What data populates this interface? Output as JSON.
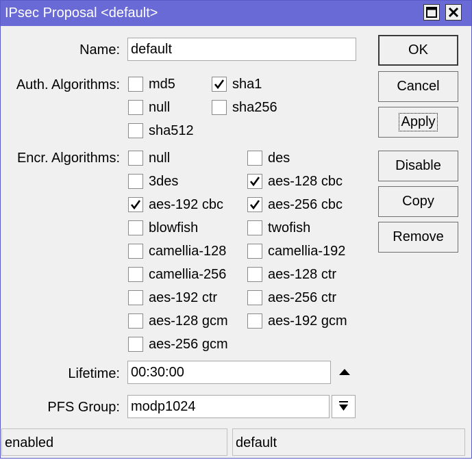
{
  "window": {
    "title": "IPsec Proposal <default>"
  },
  "form": {
    "name_label": "Name:",
    "name_value": "default",
    "auth_label": "Auth. Algorithms:",
    "auth": [
      {
        "label": "md5",
        "checked": false
      },
      {
        "label": "sha1",
        "checked": true
      },
      {
        "label": "null",
        "checked": false
      },
      {
        "label": "sha256",
        "checked": false
      },
      {
        "label": "sha512",
        "checked": false
      }
    ],
    "encr_label": "Encr. Algorithms:",
    "encr": [
      {
        "label": "null",
        "checked": false
      },
      {
        "label": "des",
        "checked": false
      },
      {
        "label": "3des",
        "checked": false
      },
      {
        "label": "aes-128 cbc",
        "checked": true
      },
      {
        "label": "aes-192 cbc",
        "checked": true
      },
      {
        "label": "aes-256 cbc",
        "checked": true
      },
      {
        "label": "blowfish",
        "checked": false
      },
      {
        "label": "twofish",
        "checked": false
      },
      {
        "label": "camellia-128",
        "checked": false
      },
      {
        "label": "camellia-192",
        "checked": false
      },
      {
        "label": "camellia-256",
        "checked": false
      },
      {
        "label": "aes-128 ctr",
        "checked": false
      },
      {
        "label": "aes-192 ctr",
        "checked": false
      },
      {
        "label": "aes-256 ctr",
        "checked": false
      },
      {
        "label": "aes-128 gcm",
        "checked": false
      },
      {
        "label": "aes-192 gcm",
        "checked": false
      },
      {
        "label": "aes-256 gcm",
        "checked": false
      }
    ],
    "lifetime_label": "Lifetime:",
    "lifetime_value": "00:30:00",
    "pfs_label": "PFS Group:",
    "pfs_value": "modp1024"
  },
  "buttons": {
    "ok": "OK",
    "cancel": "Cancel",
    "apply": "Apply",
    "disable": "Disable",
    "copy": "Copy",
    "remove": "Remove"
  },
  "status": {
    "left": "enabled",
    "right": "default"
  },
  "icons": {
    "maximize": "maximize-icon",
    "close": "close-icon",
    "lifetime_toggle": "triangle-up-icon",
    "pfs_dropdown": "dropdown-arrow-icon"
  }
}
